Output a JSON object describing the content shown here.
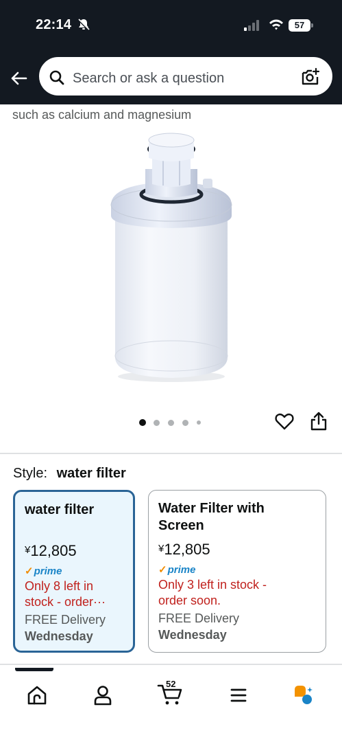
{
  "status": {
    "time": "22:14",
    "battery": "57"
  },
  "search": {
    "placeholder": "Search or ask a question"
  },
  "product": {
    "description_line": "such as calcium and magnesium",
    "image_count": 5,
    "active_image": 1
  },
  "style": {
    "label": "Style:",
    "value": "water filter"
  },
  "options": [
    {
      "title": "water filter",
      "price": "12,805",
      "currency": "¥",
      "prime": "prime",
      "stock": "Only 8 left in stock - order···",
      "stock_line1": "Only 8 left in",
      "stock_line2": "stock - order···",
      "delivery": "FREE Delivery",
      "day": "Wednesday",
      "selected": true
    },
    {
      "title": "Water Filter with Screen",
      "title_line1": "Water Filter with",
      "title_line2": "Screen",
      "price": "12,805",
      "currency": "¥",
      "prime": "prime",
      "stock_line1": "Only 3 left in stock -",
      "stock_line2": "order soon.",
      "delivery": "FREE Delivery",
      "day": "Wednesday",
      "selected": false
    }
  ],
  "tabbar": {
    "cart_count": "52",
    "icons": [
      "home-icon",
      "account-icon",
      "cart-icon",
      "menu-icon",
      "rufus-icon"
    ]
  },
  "colors": {
    "header_bg": "#131921",
    "selected_border": "#2a6496",
    "selected_bg": "#eaf6fd",
    "stock_red": "#c0211d",
    "prime_blue": "#1a84c7"
  }
}
